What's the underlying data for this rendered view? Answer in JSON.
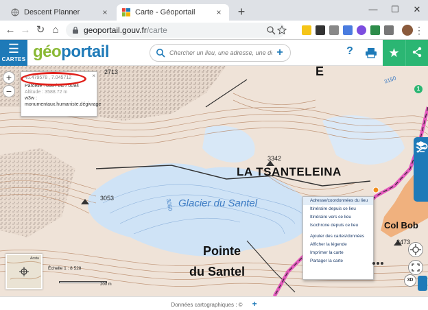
{
  "browser": {
    "tabs": [
      {
        "title": "Descent Planner",
        "close": "×"
      },
      {
        "title": "Carte - Géoportail",
        "close": "×"
      }
    ],
    "new_tab": "+",
    "window_controls": [
      "—",
      "☐",
      "✕"
    ],
    "url_host": "geoportail.gouv.fr",
    "url_path": "/carte",
    "nav": {
      "back": "←",
      "forward": "→",
      "reload": "↻",
      "home": "⌂"
    },
    "menu": "⋮"
  },
  "header": {
    "menu_label": "CARTES",
    "logo_part1": "géo",
    "logo_part2": "portail",
    "search_placeholder": "Chercher un lieu, une adresse, une donnée",
    "search_add": "+",
    "help": "?",
    "favorite": "★"
  },
  "map": {
    "labels": {
      "summit_name": "LA TSANTELEINA",
      "summit_alt": "3342",
      "glacier": "Glacier du Santel",
      "pointe_1": "Pointe",
      "pointe_2": "du Santel",
      "col": "Col Bob",
      "alt_3053": "3053",
      "alt_3473": "3473",
      "alt_2713": "2713",
      "contour_3050": "3050",
      "contour_3150": "3150",
      "letter_e": "E"
    },
    "zoom_in": "+",
    "zoom_out": "−",
    "popup": {
      "coords": "45.479578 , 7.045712",
      "parcel": "Parcelle : 000 / 0C / 0094",
      "altitude": "Altitude : 3588.72 m",
      "w3w_label": "w3w :",
      "w3w_value": "monumentaux.humaniste.dégivrage",
      "close": "×"
    },
    "context_menu": {
      "items_top": [
        "Adresse/coordonnées du lieu",
        "Itinéraire depuis ce lieu",
        "Itinéraire vers ce lieu",
        "Isochrone depuis ce lieu"
      ],
      "items_bottom": [
        "Ajouter des cartes/données",
        "Afficher la légende",
        "Imprimer la carte",
        "Partager la carte"
      ]
    },
    "layers_badge": "1",
    "scale": "Échelle 1 : 8 528",
    "scale_dist": "200 m",
    "minimap_label": "Aosta",
    "btn_3d": "3D"
  },
  "footer": {
    "text": "Données cartographiques : ©",
    "plus": "+"
  },
  "colors": {
    "brand_blue": "#1e7ab8",
    "brand_green": "#8ab935",
    "accent_green": "#2bb673",
    "ring_red": "#e0211b",
    "glacier": "#cfe3f6",
    "contour": "#b98a6a"
  }
}
